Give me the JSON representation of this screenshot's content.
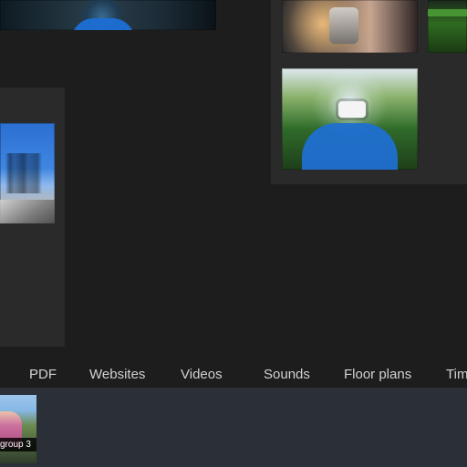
{
  "nav": {
    "items": [
      {
        "label": "PDF"
      },
      {
        "label": "Websites"
      },
      {
        "label": "Videos"
      },
      {
        "label": "Sounds"
      },
      {
        "label": "Floor plans"
      },
      {
        "label": "Tim"
      }
    ]
  },
  "thumbnails": [
    {
      "label": "group 3"
    }
  ]
}
